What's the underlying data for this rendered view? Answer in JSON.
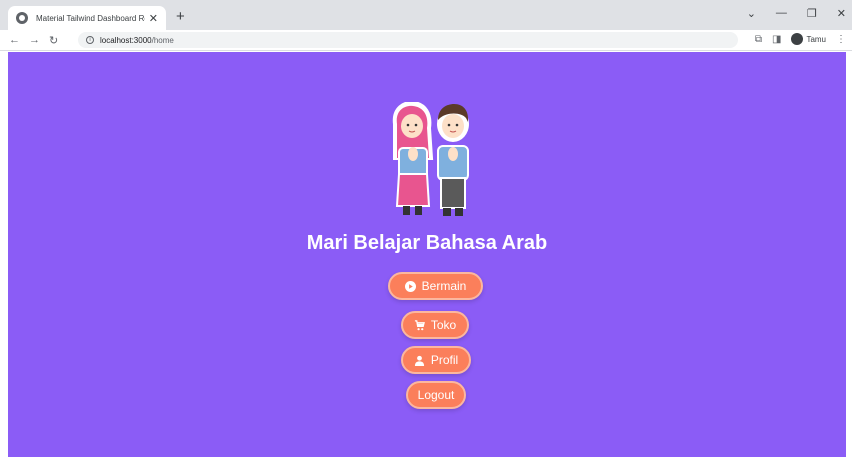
{
  "browser": {
    "tab_title": "Material Tailwind Dashboard Re...",
    "url_host": "localhost:3000",
    "url_path": "/home",
    "profile_label": "Tamu"
  },
  "main": {
    "heading": "Mari Belajar Bahasa Arab",
    "buttons": [
      {
        "label": "Bermain",
        "icon": "play-circle-icon"
      },
      {
        "label": "Toko",
        "icon": "cart-icon"
      },
      {
        "label": "Profil",
        "icon": "user-icon"
      },
      {
        "label": "Logout",
        "icon": ""
      }
    ]
  },
  "colors": {
    "background": "#8b5cf6",
    "button": "#fb7f5b"
  }
}
